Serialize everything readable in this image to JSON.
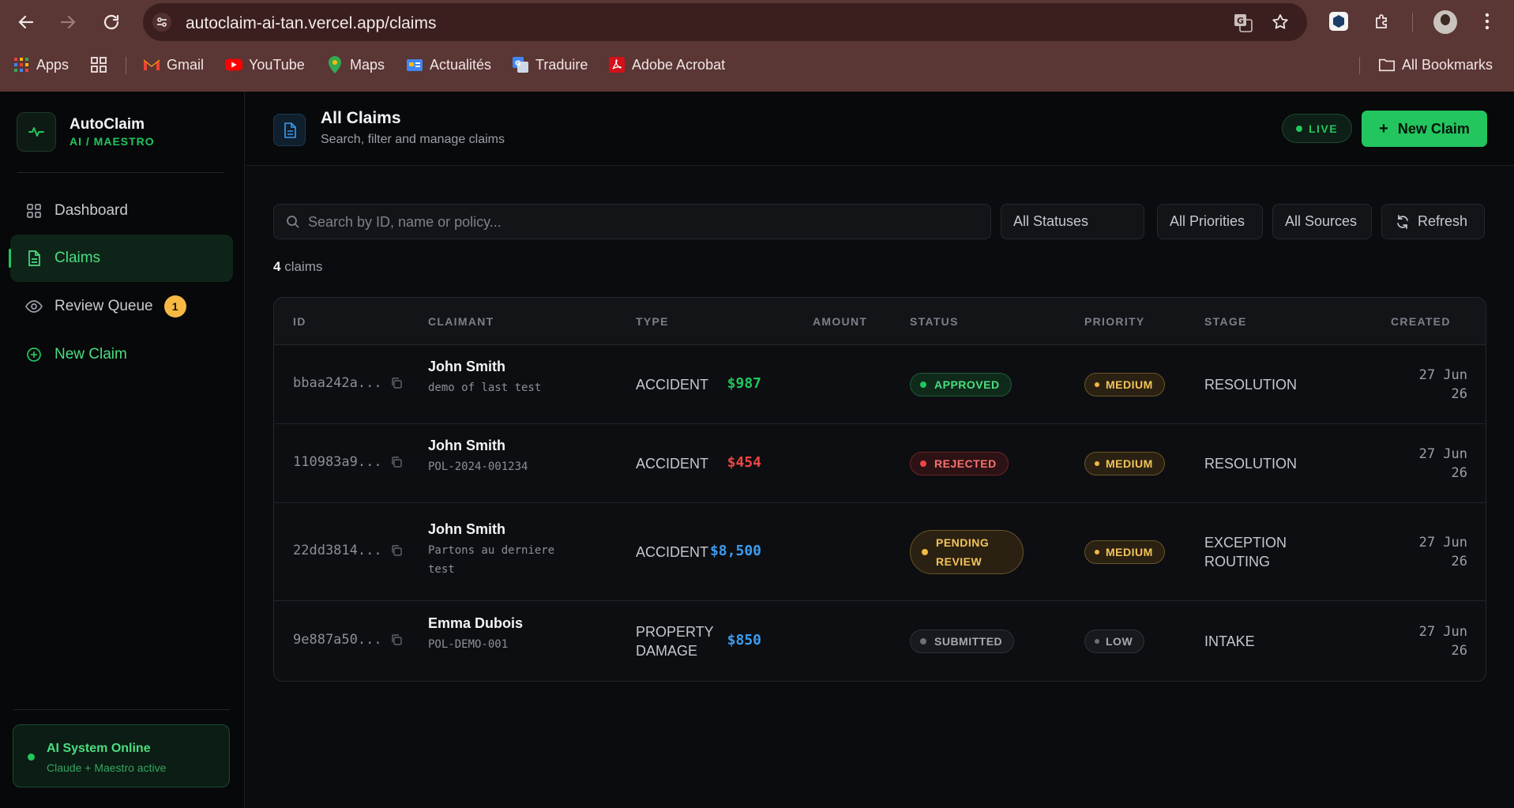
{
  "browser": {
    "url": "autoclaim-ai-tan.vercel.app/claims",
    "bookmarks": [
      "Apps",
      "Gmail",
      "YouTube",
      "Maps",
      "Actualités",
      "Traduire",
      "Adobe Acrobat"
    ],
    "all_bookmarks": "All Bookmarks"
  },
  "sidebar": {
    "brand": "AutoClaim",
    "brand_sub": "AI / MAESTRO",
    "items": [
      {
        "label": "Dashboard",
        "icon": "grid-icon"
      },
      {
        "label": "Claims",
        "icon": "document-icon",
        "active": true
      },
      {
        "label": "Review Queue",
        "icon": "eye-icon",
        "badge": "1"
      },
      {
        "label": "New Claim",
        "icon": "plus-circle-icon"
      }
    ],
    "status_title": "AI System Online",
    "status_sub": "Claude + Maestro active"
  },
  "header": {
    "title": "All Claims",
    "subtitle": "Search, filter and manage claims",
    "live": "LIVE",
    "new_claim": "New Claim"
  },
  "filters": {
    "search_placeholder": "Search by ID, name or policy...",
    "statuses": "All Statuses",
    "priorities": "All Priorities",
    "sources": "All Sources",
    "refresh": "Refresh"
  },
  "count": {
    "value": "4",
    "label": "claims"
  },
  "table": {
    "columns": [
      "ID",
      "CLAIMANT",
      "TYPE",
      "AMOUNT",
      "STATUS",
      "PRIORITY",
      "STAGE",
      "CREATED"
    ],
    "rows": [
      {
        "id": "bbaa242a...",
        "name": "John Smith",
        "sub1": "demo of last test",
        "sub2": "",
        "type1": "ACCIDENT",
        "type2": "",
        "amount": "$987",
        "amount_color": "#22c55e",
        "status1": "APPROVED",
        "status2": "",
        "status_kind": "green",
        "priority": "MEDIUM",
        "priority_kind": "amber",
        "stage1": "RESOLUTION",
        "stage2": "",
        "date1": "27 Jun",
        "date2": "26"
      },
      {
        "id": "110983a9...",
        "name": "John Smith",
        "sub1": "POL-2024-001234",
        "sub2": "",
        "type1": "ACCIDENT",
        "type2": "",
        "amount": "$454",
        "amount_color": "#ef4444",
        "status1": "REJECTED",
        "status2": "",
        "status_kind": "red",
        "priority": "MEDIUM",
        "priority_kind": "amber",
        "stage1": "RESOLUTION",
        "stage2": "",
        "date1": "27 Jun",
        "date2": "26"
      },
      {
        "id": "22dd3814...",
        "name": "John Smith",
        "sub1": "Partons au derniere",
        "sub2": "test",
        "type1": "ACCIDENT",
        "type2": "",
        "amount": "$8,500",
        "amount_color": "#3b9cf0",
        "status1": "PENDING",
        "status2": "REVIEW",
        "status_kind": "amber",
        "priority": "MEDIUM",
        "priority_kind": "amber",
        "stage1": "EXCEPTION",
        "stage2": "ROUTING",
        "date1": "27 Jun",
        "date2": "26"
      },
      {
        "id": "9e887a50...",
        "name": "Emma Dubois",
        "sub1": "POL-DEMO-001",
        "sub2": "",
        "type1": "PROPERTY",
        "type2": "DAMAGE",
        "amount": "$850",
        "amount_color": "#3b9cf0",
        "status1": "SUBMITTED",
        "status2": "",
        "status_kind": "gray",
        "priority": "LOW",
        "priority_kind": "gray",
        "stage1": "INTAKE",
        "stage2": "",
        "date1": "27 Jun",
        "date2": "26"
      }
    ]
  }
}
